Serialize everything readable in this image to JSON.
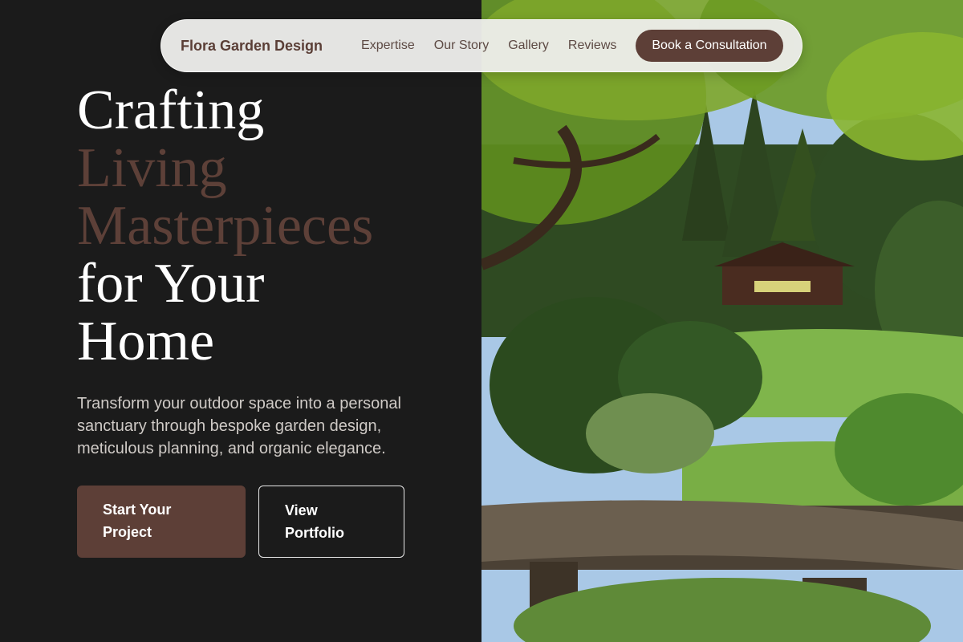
{
  "nav": {
    "brand": "Flora Garden Design",
    "links": [
      "Expertise",
      "Our Story",
      "Gallery",
      "Reviews"
    ],
    "cta": "Book a Consultation"
  },
  "hero": {
    "headline": {
      "line1": "Crafting",
      "line2": "Living",
      "line3": "Masterpieces",
      "line4": "for Your",
      "line5": "Home"
    },
    "subtitle": "Transform your outdoor space into a personal sanctuary through bespoke garden design, meticulous planning, and organic elegance.",
    "primary_button": "Start Your Project",
    "secondary_button": "View Portfolio"
  },
  "colors": {
    "background": "#1b1b1b",
    "accent": "#5d3f37",
    "nav_bg": "#ecece9"
  },
  "icons": [
    "garden-photo"
  ]
}
